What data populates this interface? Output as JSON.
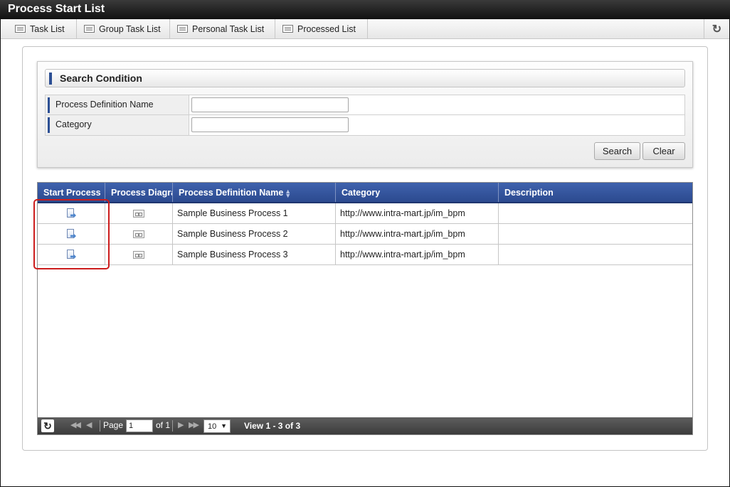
{
  "window": {
    "title": "Process Start List"
  },
  "tabs": [
    {
      "label": "Task List"
    },
    {
      "label": "Group Task List"
    },
    {
      "label": "Personal Task List"
    },
    {
      "label": "Processed List"
    }
  ],
  "search": {
    "title": "Search Condition",
    "fields": [
      {
        "label": "Process Definition Name",
        "value": ""
      },
      {
        "label": "Category",
        "value": ""
      }
    ],
    "search_label": "Search",
    "clear_label": "Clear"
  },
  "grid": {
    "columns": [
      {
        "label": "Start Process"
      },
      {
        "label": "Process Diagram"
      },
      {
        "label": "Process Definition Name"
      },
      {
        "label": "Category"
      },
      {
        "label": "Description"
      }
    ],
    "rows": [
      {
        "name": "Sample Business Process 1",
        "category": "http://www.intra-mart.jp/im_bpm",
        "description": ""
      },
      {
        "name": "Sample Business Process 2",
        "category": "http://www.intra-mart.jp/im_bpm",
        "description": ""
      },
      {
        "name": "Sample Business Process 3",
        "category": "http://www.intra-mart.jp/im_bpm",
        "description": ""
      }
    ]
  },
  "pager": {
    "page_label": "Page",
    "current_page": "1",
    "of_label": "of 1",
    "page_size": "10",
    "view_text": "View 1 - 3 of 3"
  },
  "colors": {
    "grid_header": "#2c4a8f",
    "highlight": "#cc1c1c",
    "accent_bar": "#2c4f94"
  },
  "icons": {
    "tab": "list-icon",
    "refresh": "refresh-icon",
    "start": "start-process-icon",
    "diagram": "process-diagram-icon"
  }
}
